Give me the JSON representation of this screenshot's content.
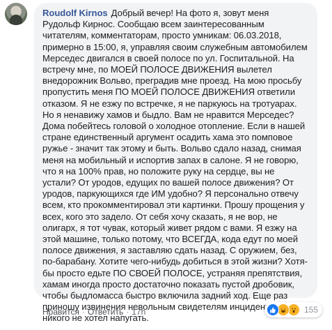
{
  "comment": {
    "author": "Roudolf Kirnos",
    "text": "Добрый вечер! На фото я, зовут меня Рудольф Кирнос. Сообщаю всем заинтересованным читателям, комментаторам, просто умникам: 06.03.2018, примерно в 15:00, я, управляя своим служебным автомобилем Мерседес двигался в своей полосе по ул. Госпитальной. На встречу мне, по МОЕЙ ПОЛОСЕ ДВИЖЕНИЯ вылетел внедорожник Вольво, преградив мне проезд. На мою просьбу пропустить меня ПО МОЕЙ ПОЛОСЕ ДВИЖЕНИЯ ответили отказом. Я не езжу по встречке, я не паркуюсь на тротуарах. Но я ненавижу хамов и быдло. Вам не нравится Мерседес? Дома побейтесь головой о холодное отопление. Если в нашей стране единственный аргумент осадить хама это помповое ружье - значит так этому и быть. Вольво сдало назад, снимая меня на мобильный и испортив запах в салоне. Я не говорю, что я на 100% прав, но положите руку на сердце, вы не устали? От уродов, едущих по вашей полосе движения? От уродов, паркующихся где ИМ удобно? Я персонально отвечу всем, кто прокомментировал эти картинки. Прошу прощения у всех, кого это задело. От себя хочу сказать, я не вор, не олигарх, я тот чувак, который живет рядом с вами. Я езжу на этой машине, только потому, что ВСЕГДА, кода едут по моей полосе движения, я заставляю сдать назад. С оружием, без, по-барабану. Хотите чего-нибудь добиться в этой жизни? Хотя-бы просто едьте ПО СВОЕЙ ПОЛОСЕ, устраняя препятствия, хамам иногда просто достаточно показать пустой дробовик, чтобы быдломасса быстро включила задний ход. Еще раз приношу извинения невольным свидетелям инцидента, я никого не хотел напугать."
  },
  "actions": {
    "like_label": "Нравится",
    "reply_label": "Ответить",
    "separator": "·",
    "time": "17h"
  },
  "reactions": {
    "types": [
      "like",
      "haha",
      "wow"
    ],
    "count": "155",
    "colors": {
      "like": "#1877f2",
      "haha": "#f7b125",
      "wow": "#f7b125"
    }
  },
  "colors": {
    "author": "#385898",
    "bubble": "#f2f3f5",
    "text": "#1c1e21",
    "meta": "#606770"
  }
}
